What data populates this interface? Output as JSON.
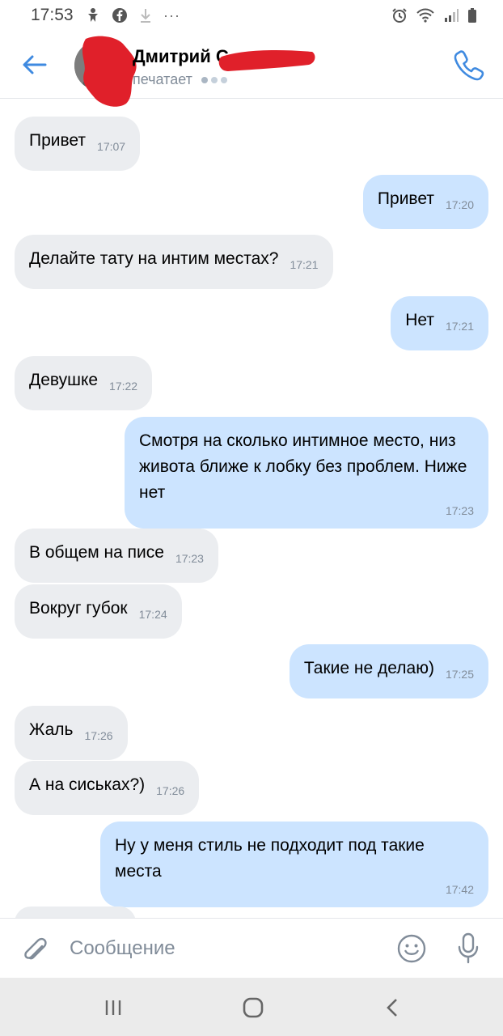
{
  "status_bar": {
    "time": "17:53",
    "icons": [
      "accessibility-icon",
      "facebook-icon",
      "download-icon",
      "more-icon",
      "alarm-icon",
      "wifi-icon",
      "signal-icon",
      "battery-icon"
    ],
    "more": "···"
  },
  "header": {
    "contact_name": "Дмитрий С",
    "status": "печатает",
    "accent_color": "#3f8ae0"
  },
  "messages": [
    {
      "direction": "in",
      "text": "Привет",
      "time": "17:07"
    },
    {
      "direction": "out",
      "text": "Привет",
      "time": "17:20"
    },
    {
      "direction": "in",
      "text": "Делайте тату на интим местах?",
      "time": "17:21"
    },
    {
      "direction": "out",
      "text": "Нет",
      "time": "17:21"
    },
    {
      "direction": "in",
      "text": "Девушке",
      "time": "17:22"
    },
    {
      "direction": "out",
      "text": "Смотря на сколько интимное место, низ живота ближе к лобку без проблем. Ниже нет",
      "time": "17:23"
    },
    {
      "direction": "in",
      "text": "В общем на писе",
      "time": "17:23"
    },
    {
      "direction": "in",
      "text": "Вокруг губок",
      "time": "17:24"
    },
    {
      "direction": "out",
      "text": "Такие не делаю)",
      "time": "17:25"
    },
    {
      "direction": "in",
      "text": "Жаль",
      "time": "17:26"
    },
    {
      "direction": "in",
      "text": "А на сиськах?)",
      "time": "17:26"
    },
    {
      "direction": "out",
      "text": "Ну у меня стиль не подходит под такие места",
      "time": "17:42"
    }
  ],
  "composer": {
    "placeholder": "Сообщение"
  },
  "colors": {
    "incoming_bubble": "#ebedf0",
    "outgoing_bubble": "#cce4ff",
    "time_text": "#818c99",
    "redaction": "#e0202a"
  }
}
